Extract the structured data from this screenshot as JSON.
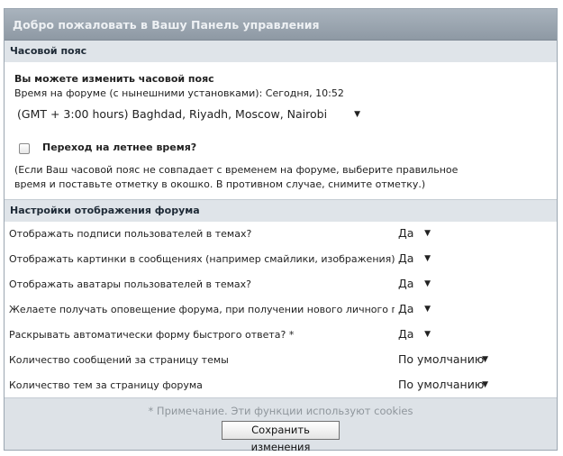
{
  "panel": {
    "title": "Добро пожаловать в Вашу Панель управления"
  },
  "timezone": {
    "section_title": "Часовой пояс",
    "change_title": "Вы можете изменить часовой пояс",
    "forum_time_label": "Время на форуме (с нынешними установками): Сегодня, 10:52",
    "selected_zone": "(GMT + 3:00 hours) Baghdad, Riyadh, Moscow, Nairobi",
    "dst_label": "Переход на летнее время?",
    "dst_checked": false,
    "hint_line1": "(Если Ваш часовой пояс не совпадает с временем на форуме, выберите правильное",
    "hint_line2": "время и поставьте отметку в окошко. В противном случае, снимите отметку.)"
  },
  "display": {
    "section_title": "Настройки отображения форума",
    "rows": [
      {
        "label": "Отображать подписи пользователей в темах?",
        "value": "Да"
      },
      {
        "label": "Отображать картинки в сообщениях (например смайлики, изображения)?",
        "value": "Да"
      },
      {
        "label": "Отображать аватары пользователей в темах?",
        "value": "Да"
      },
      {
        "label": "Желаете получать оповещение форума, при получении нового личного письма?",
        "value": "Да"
      },
      {
        "label": "Раскрывать автоматически форму быстрого ответа? *",
        "value": "Да"
      },
      {
        "label": "Количество сообщений за страницу темы",
        "value": "По умолчанию"
      },
      {
        "label": "Количество тем за страницу форума",
        "value": "По умолчанию"
      }
    ]
  },
  "footer": {
    "note": "* Примечание. Эти функции используют cookies",
    "save_label": "Сохранить изменения"
  },
  "icons": {
    "dropdown_arrow": "▼"
  }
}
